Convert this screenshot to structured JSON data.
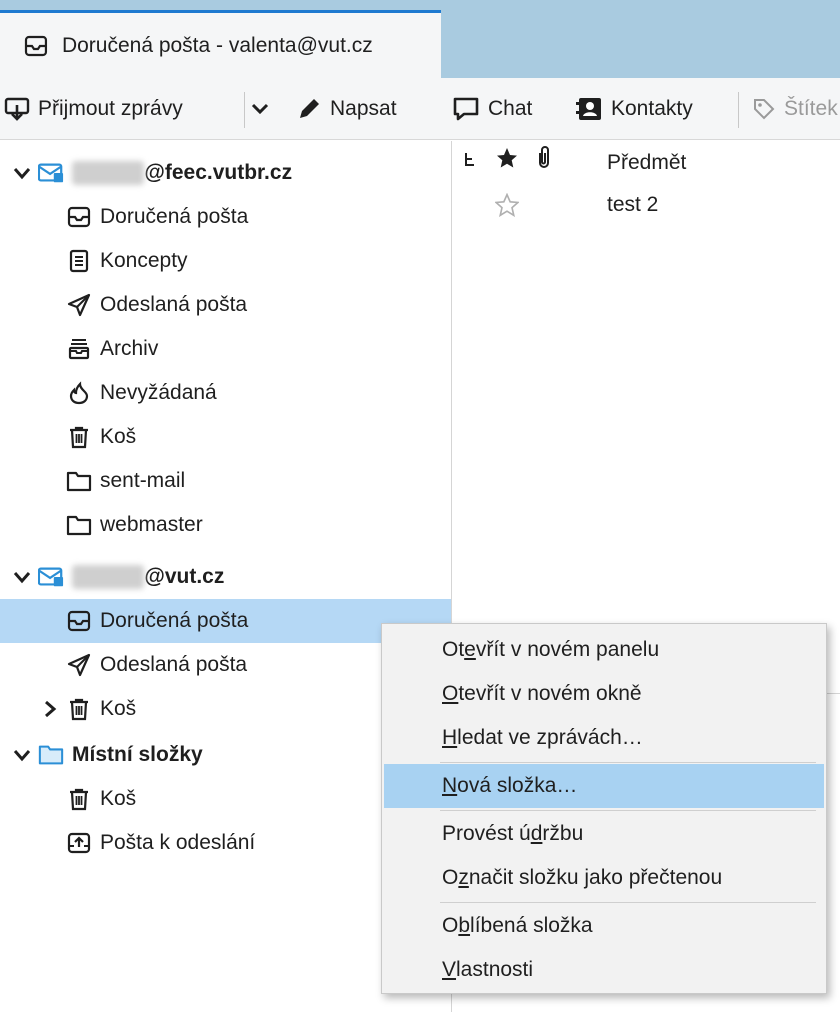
{
  "tab": {
    "title": "Doručená pošta - valenta@vut.cz"
  },
  "toolbar": {
    "get_messages": "Přijmout zprávy",
    "write": "Napsat",
    "chat": "Chat",
    "contacts": "Kontakty",
    "tags": "Štítek"
  },
  "accounts": [
    {
      "name_hidden": "valenta",
      "name_visible": "@feec.vutbr.cz",
      "folders": [
        "Doručená pošta",
        "Koncepty",
        "Odeslaná pošta",
        "Archiv",
        "Nevyžádaná",
        "Koš",
        "sent-mail",
        "webmaster"
      ]
    },
    {
      "name_hidden": "valenta",
      "name_visible": "@vut.cz",
      "folders": [
        "Doručená pošta",
        "Odeslaná pošta",
        "Koš"
      ]
    },
    {
      "name": "Místní složky",
      "folders": [
        "Koš",
        "Pošta k odeslání"
      ]
    }
  ],
  "messages": {
    "subject_header": "Předmět",
    "rows": [
      {
        "subject": "test 2",
        "starred": false
      }
    ]
  },
  "context_menu": {
    "items": [
      {
        "pre": "Ot",
        "u": "e",
        "post": "vřít v novém panelu"
      },
      {
        "pre": "",
        "u": "O",
        "post": "tevřít v novém okně"
      },
      {
        "pre": "",
        "u": "H",
        "post": "ledat ve zprávách…"
      },
      {
        "pre": "",
        "u": "N",
        "post": "ová složka…"
      },
      {
        "pre": "Provést ú",
        "u": "d",
        "post": "ržbu"
      },
      {
        "pre": "O",
        "u": "z",
        "post": "načit složku jako přečtenou"
      },
      {
        "pre": "O",
        "u": "b",
        "post": "líbená složka"
      },
      {
        "pre": "",
        "u": "V",
        "post": "lastnosti"
      }
    ],
    "highlighted_index": 3
  },
  "colors": {
    "tabstrip": "#a9cbe0",
    "active_tab_border": "#1f7ad0",
    "selected_row": "#b5d8f5",
    "menu_highlight": "#a8d2f2",
    "account_icon": "#2b8fd6"
  }
}
